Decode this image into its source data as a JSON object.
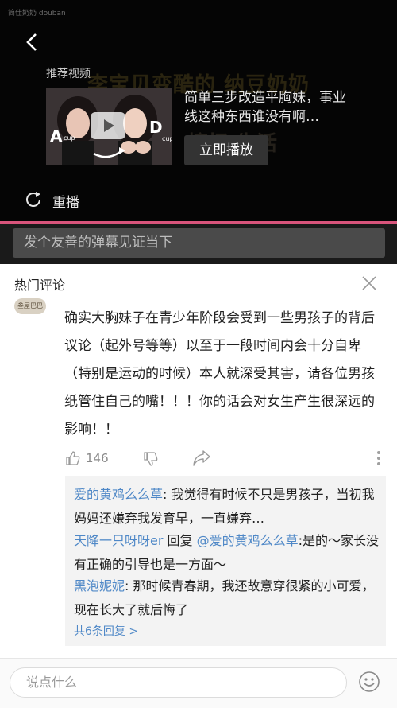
{
  "video": {
    "watermark": "简仕奶奶 douban",
    "recommend_label": "推荐视频",
    "background_title_line1": "李宝贝变酷的 纳豆奶奶",
    "background_title_line2": "搞怪 生活",
    "recommended_title": "简单三步改造平胸妹，事业线这种东西谁没有啊…",
    "play_now": "立即播放",
    "thumb_left_letter": "A",
    "thumb_left_sub": "cup",
    "thumb_right_letter": "D",
    "thumb_right_sub": "cup",
    "replay": "重播",
    "progress_color": "#d8547b"
  },
  "danmaku": {
    "placeholder": "发个友善的弹幕见证当下"
  },
  "comments": {
    "section_title": "热门评论",
    "avatar_text": "叁屋巴巴",
    "main_comment": "确实大胸妹子在青少年阶段会受到一些男孩子的背后议论（起外号等等）以至于一段时间内会十分自卑（特别是运动的时候）本人就深受其害，请各位男孩纸管住自己的嘴！！！你的话会对女生产生很深远的影响！！",
    "like_count": "146",
    "replies": [
      {
        "user": "爱的黄鸡么么草",
        "sep": ": ",
        "text": "我觉得有时候不只是男孩子，当初我妈妈还嫌弃我发育早，一直嫌弃…"
      },
      {
        "user": "天降一只呀呀er",
        "mid": " 回复 ",
        "target": "@爱的黄鸡么么草",
        "sep": ":",
        "text": "是的～家长没有正确的引导也是一方面～"
      },
      {
        "user": "黑泡妮妮",
        "sep": ": ",
        "text": "那时候青春期，我还故意穿很紧的小可爱，现在长大了就后悔了"
      }
    ],
    "more_replies": "共6条回复 >"
  },
  "bottom": {
    "comment_placeholder": "说点什么"
  },
  "icons": [
    "back-icon",
    "replay-icon",
    "close-icon",
    "like-icon",
    "dislike-icon",
    "share-icon",
    "more-icon",
    "emoji-icon",
    "play-icon"
  ]
}
